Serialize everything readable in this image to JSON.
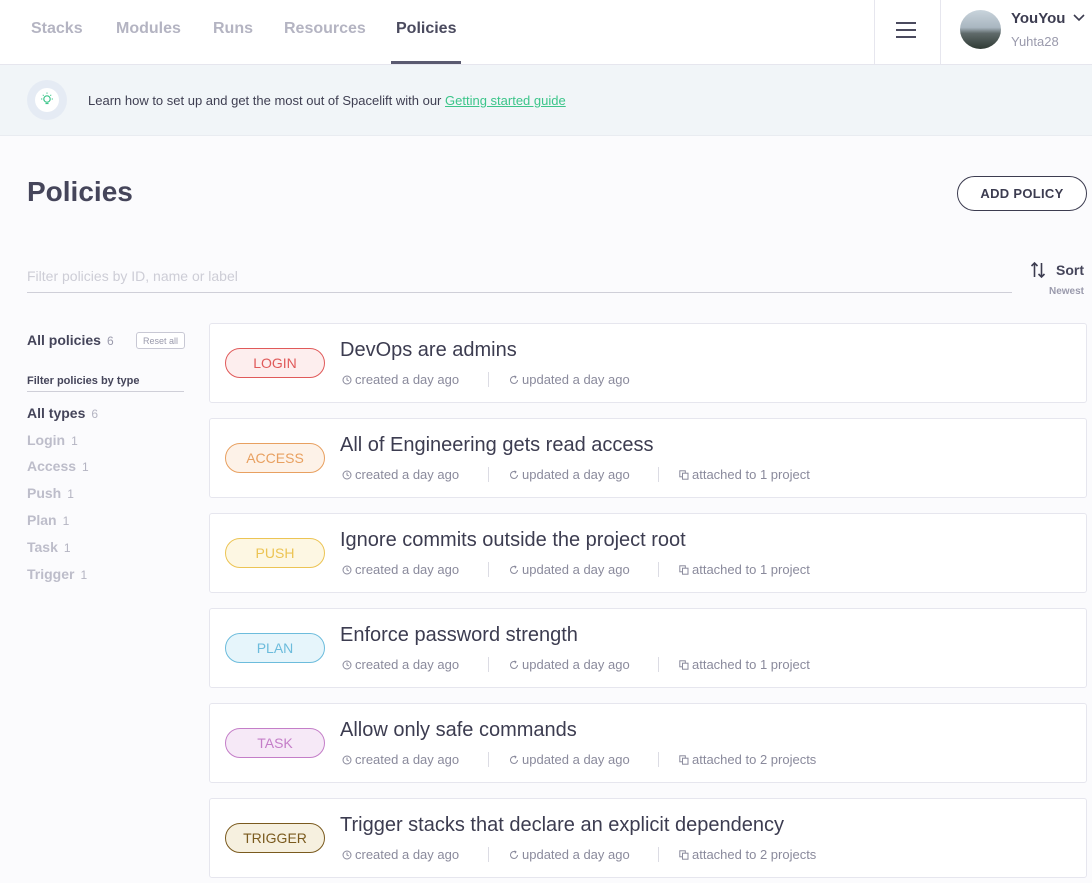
{
  "nav": {
    "tabs": [
      "Stacks",
      "Modules",
      "Runs",
      "Resources",
      "Policies"
    ],
    "active_tab": "Policies",
    "user_name": "YouYou",
    "user_handle": "Yuhta28"
  },
  "banner": {
    "text": "Learn how to set up and get the most out of Spacelift with our",
    "link": "Getting started guide"
  },
  "header": {
    "title": "Policies",
    "add_button": "ADD POLICY"
  },
  "filter": {
    "placeholder": "Filter policies by ID, name or label",
    "sort_label": "Sort",
    "sort_value": "Newest"
  },
  "sidebar": {
    "all_label": "All policies",
    "all_count": "6",
    "reset_label": "Reset all",
    "heading": "Filter policies by type",
    "types": [
      {
        "label": "All types",
        "count": "6"
      },
      {
        "label": "Login",
        "count": "1"
      },
      {
        "label": "Access",
        "count": "1"
      },
      {
        "label": "Push",
        "count": "1"
      },
      {
        "label": "Plan",
        "count": "1"
      },
      {
        "label": "Task",
        "count": "1"
      },
      {
        "label": "Trigger",
        "count": "1"
      }
    ]
  },
  "policies": [
    {
      "type": "LOGIN",
      "name": "DevOps are admins",
      "created": "created a day ago",
      "updated": "updated a day ago",
      "attached": "",
      "color": "#e05a5a",
      "bg": "#fdeeee"
    },
    {
      "type": "ACCESS",
      "name": "All of Engineering gets read access",
      "created": "created a day ago",
      "updated": "updated a day ago",
      "attached": "attached to 1 project",
      "color": "#e8a060",
      "bg": "#fdf2e8"
    },
    {
      "type": "PUSH",
      "name": "Ignore commits outside the project root",
      "created": "created a day ago",
      "updated": "updated a day ago",
      "attached": "attached to 1 project",
      "color": "#ecc454",
      "bg": "#fdf7e3"
    },
    {
      "type": "PLAN",
      "name": "Enforce password strength",
      "created": "created a day ago",
      "updated": "updated a day ago",
      "attached": "attached to 1 project",
      "color": "#6cbcdc",
      "bg": "#e6f5fb"
    },
    {
      "type": "TASK",
      "name": "Allow only safe commands",
      "created": "created a day ago",
      "updated": "updated a day ago",
      "attached": "attached to 2 projects",
      "color": "#c47ec8",
      "bg": "#f6e9f7"
    },
    {
      "type": "TRIGGER",
      "name": "Trigger stacks that declare an explicit dependency",
      "created": "created a day ago",
      "updated": "updated a day ago",
      "attached": "attached to 2 projects",
      "color": "#7a5a1e",
      "bg": "#f6f0df"
    }
  ]
}
